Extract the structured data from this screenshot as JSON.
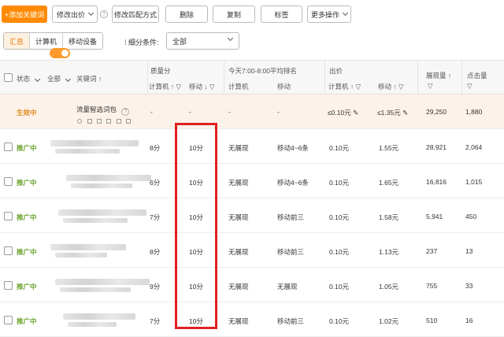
{
  "toolbar": {
    "add_keyword": "+添加关键词",
    "modify_bid": "修改出价",
    "help": "?",
    "modify_match": "修改匹配方式",
    "delete": "删除",
    "copy": "复制",
    "tag": "标签",
    "more_ops": "更多操作"
  },
  "filterbar": {
    "tabs": [
      "汇总",
      "计算机",
      "移动设备"
    ],
    "active_tab": 0,
    "filter_label": "细分条件:",
    "filter_value": "全部"
  },
  "table": {
    "headers": {
      "status": "状态",
      "all": "全部",
      "keyword": "关键词 ↑",
      "quality": "质量分",
      "quality_pc": "计算机 ↑",
      "quality_mobile": "移动 ↓",
      "rank": "今天7:00-8:00平均排名",
      "rank_pc": "计算机",
      "rank_mobile": "移动",
      "bid": "出价",
      "bid_pc": "计算机 ↑",
      "bid_mobile": "移动 ↑",
      "impressions": "展现量 ↑",
      "clicks": "点击量"
    },
    "summary": {
      "status": "生效中",
      "name": "流量智选词包",
      "help": "?",
      "quality_pc": "-",
      "quality_mobile": "-",
      "rank_pc": "-",
      "rank_mobile": "-",
      "bid_pc": "≤0.10元",
      "bid_mobile": "≤1.35元",
      "impressions": "29,250",
      "clicks": "1,880"
    },
    "rows": [
      {
        "status": "推广中",
        "quality_pc": "8分",
        "quality_mobile": "10分",
        "rank_pc": "无展现",
        "rank_mobile": "移动4~6条",
        "bid_pc": "0.10元",
        "bid_mobile": "1.55元",
        "impressions": "28,921",
        "clicks": "2,064"
      },
      {
        "status": "推广中",
        "quality_pc": "6分",
        "quality_mobile": "10分",
        "rank_pc": "无展现",
        "rank_mobile": "移动4~6条",
        "bid_pc": "0.10元",
        "bid_mobile": "1.65元",
        "impressions": "16,816",
        "clicks": "1,015"
      },
      {
        "status": "推广中",
        "quality_pc": "7分",
        "quality_mobile": "10分",
        "rank_pc": "无展现",
        "rank_mobile": "移动前三",
        "bid_pc": "0.10元",
        "bid_mobile": "1.58元",
        "impressions": "5,941",
        "clicks": "450"
      },
      {
        "status": "推广中",
        "quality_pc": "8分",
        "quality_mobile": "10分",
        "rank_pc": "无展现",
        "rank_mobile": "移动前三",
        "bid_pc": "0.10元",
        "bid_mobile": "1.13元",
        "impressions": "237",
        "clicks": "13"
      },
      {
        "status": "推广中",
        "quality_pc": "9分",
        "quality_mobile": "10分",
        "rank_pc": "无展现",
        "rank_mobile": "无展现",
        "bid_pc": "0.10元",
        "bid_mobile": "1.05元",
        "impressions": "755",
        "clicks": "33"
      },
      {
        "status": "推广中",
        "quality_pc": "7分",
        "quality_mobile": "10分",
        "rank_pc": "无展现",
        "rank_mobile": "移动前三",
        "bid_pc": "0.10元",
        "bid_mobile": "1.02元",
        "impressions": "510",
        "clicks": "16"
      }
    ]
  },
  "colors": {
    "accent": "#ff8a00",
    "status_green": "#6aa12a",
    "highlight_red": "#e02020",
    "summary_bg": "#fdf2ea"
  },
  "icons": {
    "filter": "funnel-icon",
    "sort": "arrow-icon",
    "edit": "pencil-icon"
  }
}
